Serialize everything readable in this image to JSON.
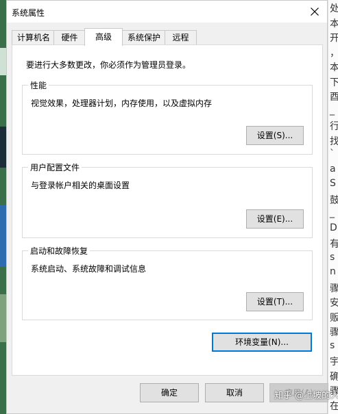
{
  "window": {
    "title": "系统属性",
    "close_icon": "close-icon"
  },
  "tabs": [
    {
      "label": "计算机名",
      "active": false
    },
    {
      "label": "硬件",
      "active": false
    },
    {
      "label": "高级",
      "active": true
    },
    {
      "label": "系统保护",
      "active": false
    },
    {
      "label": "远程",
      "active": false
    }
  ],
  "notice": "要进行大多数更改，你必须作为管理员登录。",
  "groups": {
    "performance": {
      "title": "性能",
      "description": "视觉效果，处理器计划，内存使用，以及虚拟内存",
      "button": "设置(S)..."
    },
    "user_profiles": {
      "title": "用户配置文件",
      "description": "与登录帐户相关的桌面设置",
      "button": "设置(E)..."
    },
    "startup_recovery": {
      "title": "启动和故障恢复",
      "description": "系统启动、系统故障和调试信息",
      "button": "设置(T)..."
    }
  },
  "env_button": "环境变量(N)...",
  "footer": {
    "ok": "确定",
    "cancel": "取消",
    "apply": "应用(A)"
  },
  "watermark": "知乎 @上坡的人",
  "background_right_text": [
    "处",
    "本",
    "开",
    "，",
    "本",
    "下",
    "酉",
    "_",
    "行",
    "找",
    "`",
    "a",
    "S",
    "鼓",
    "_",
    "D",
    "有",
    "s",
    "n",
    "骤",
    "安",
    "贩",
    "骤",
    "s",
    "宇",
    "确",
    "骤",
    "在"
  ],
  "colors": {
    "accent": "#0078d7",
    "dialog_bg": "#f0f0f0",
    "panel_bg": "#ffffff"
  }
}
